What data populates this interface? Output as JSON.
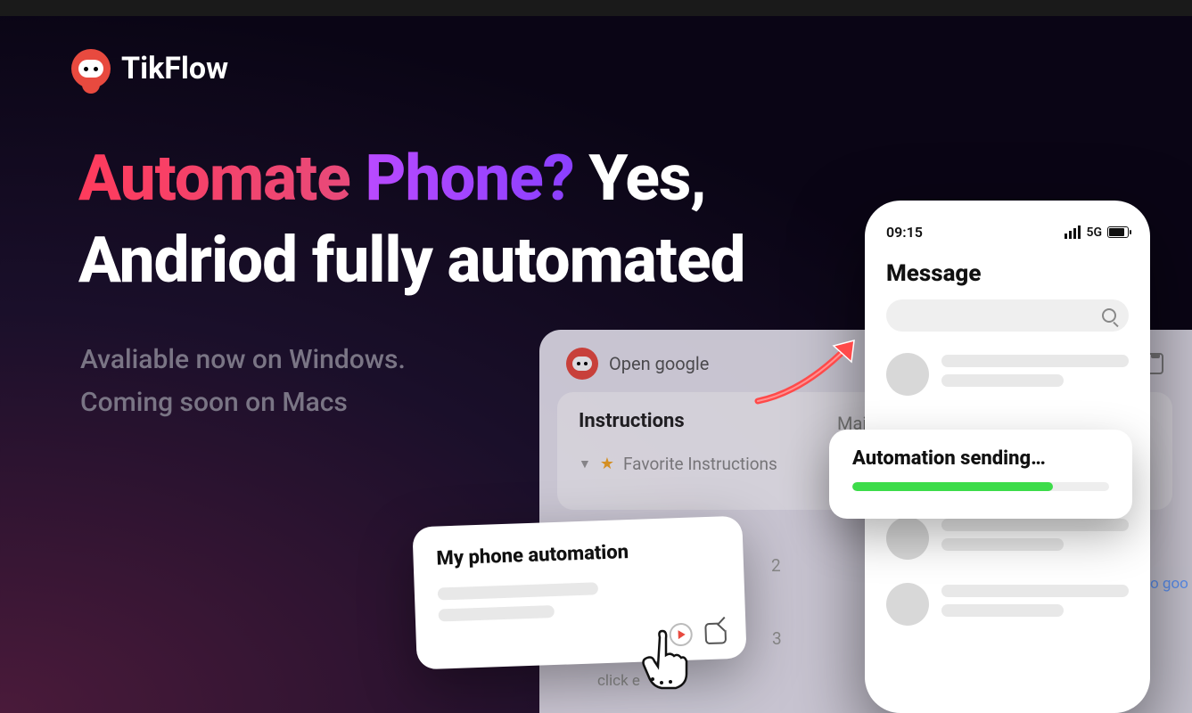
{
  "brand": "TikFlow",
  "headline": {
    "automate": "Automate",
    "phone": "Phone?",
    "yes": "Yes,",
    "line2": "Andriod fully  automated"
  },
  "subhead": {
    "line1": "Avaliable now on Windows.",
    "line2": "Coming soon on Macs"
  },
  "app": {
    "header_text": "Open google",
    "panel_title": "Instructions",
    "favorite_label": "Favorite Instructions",
    "click_label": "click e",
    "mai": "Mai",
    "row2": "2",
    "row3": "3",
    "goo_fragment": "o goo"
  },
  "card_myphone": {
    "title": "My phone automation"
  },
  "phone": {
    "time": "09:15",
    "network": "5G",
    "screen_title": "Message"
  },
  "popup": {
    "title": "Automation sending…"
  }
}
